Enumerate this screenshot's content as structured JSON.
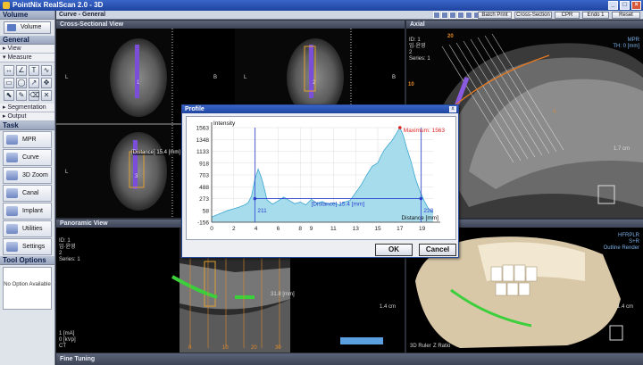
{
  "window": {
    "title": "PointNix RealScan 2.0 - 3D"
  },
  "left_panel": {
    "volume_header": "Volume",
    "volume_button": "Volume",
    "general_header": "General",
    "view_section": "View",
    "measure_section": "Measure",
    "segmentation_section": "Segmentation",
    "output_section": "Output",
    "task_header": "Task",
    "tasks": [
      "MPR",
      "Curve",
      "3D Zoom",
      "Canal",
      "Implant",
      "Utilities",
      "Settings"
    ],
    "tool_options_header": "Tool Options",
    "tool_options_text": "No Option Available"
  },
  "toolbar": {
    "curve_title": "Curve - General",
    "buttons": [
      "Batch Print",
      "Cross-Section",
      "CPR",
      "Endo 1",
      "Reset"
    ]
  },
  "panels": {
    "cross_sectional": "Cross-Sectional View",
    "axial": "Axial",
    "panoramic": "Panoramic View",
    "fine_tuning": "Fine Tuning"
  },
  "axial": {
    "info": [
      "ID: 1",
      "임·윤영",
      "2",
      "Series: 1"
    ],
    "top_right": [
      "MPR",
      "TH: 0 [mm]"
    ],
    "scale": "1.7 cm",
    "markers": [
      "20",
      "10"
    ],
    "letter": "L"
  },
  "cross_section": {
    "tiles": [
      "1",
      "2",
      "3"
    ],
    "measure_label": "[Distance] 15.4 [mm]",
    "letters": [
      "L",
      "B",
      "L",
      "B",
      "L"
    ]
  },
  "panoramic": {
    "info": [
      "ID: 1",
      "임·윤영",
      "2",
      "Series: 1"
    ],
    "bottom_left": [
      "1 [mA]",
      "0 [kVp]",
      "CT"
    ],
    "scale": "1.4 cm",
    "measure": "31.8 [mm]",
    "ticks": [
      "0",
      "10",
      "20",
      "30"
    ]
  },
  "volume3d": {
    "scale": "1.4 cm",
    "top_right": [
      "HFRPLR",
      "S+R",
      "Outline Render"
    ],
    "bottom_labels": [
      "3D Ruler",
      "Z Ratio"
    ]
  },
  "profile_dialog": {
    "title": "Profile",
    "ok": "OK",
    "cancel": "Cancel",
    "close": "x"
  },
  "chart_data": {
    "type": "line",
    "title": "",
    "xlabel": "Distance [mm]",
    "ylabel": "Intensity",
    "xlim": [
      0,
      20
    ],
    "ylim": [
      -156,
      1563
    ],
    "yticks": [
      1563,
      1348,
      1133,
      918,
      703,
      488,
      273,
      58,
      -156
    ],
    "xticks": [
      0,
      2,
      4,
      6,
      8,
      9,
      11,
      13,
      15,
      17,
      19
    ],
    "x": [
      0,
      0.5,
      1,
      1.5,
      2,
      2.5,
      3,
      3.3,
      3.6,
      3.9,
      4.2,
      4.5,
      4.8,
      5,
      5.5,
      6,
      6.5,
      7,
      7.5,
      8,
      8.5,
      9,
      9.5,
      10,
      10.5,
      11,
      11.5,
      12,
      12.5,
      13,
      13.5,
      14,
      14.5,
      15,
      15.3,
      15.6,
      16,
      16.3,
      16.6,
      17,
      17.3,
      17.6,
      18,
      18.4,
      18.8,
      19.2,
      19.6,
      20
    ],
    "values": [
      -60,
      -20,
      20,
      60,
      90,
      120,
      160,
      200,
      320,
      620,
      810,
      650,
      420,
      250,
      170,
      230,
      300,
      240,
      180,
      210,
      160,
      260,
      190,
      220,
      170,
      200,
      160,
      210,
      240,
      380,
      520,
      700,
      860,
      920,
      1050,
      1160,
      1260,
      1330,
      1430,
      1563,
      1420,
      1200,
      950,
      640,
      410,
      230,
      80,
      20
    ],
    "markers": [
      {
        "x": 3.9,
        "label": "211"
      },
      {
        "x": 18.9,
        "label": "228"
      }
    ],
    "annotations": [
      "[Distance] 15.4 [mm]",
      "Maximum: 1563"
    ],
    "colors": {
      "fill": "#a7dcec",
      "stroke": "#3aa6cf",
      "marker": "#2a3fd0",
      "max": "#e02020"
    }
  }
}
